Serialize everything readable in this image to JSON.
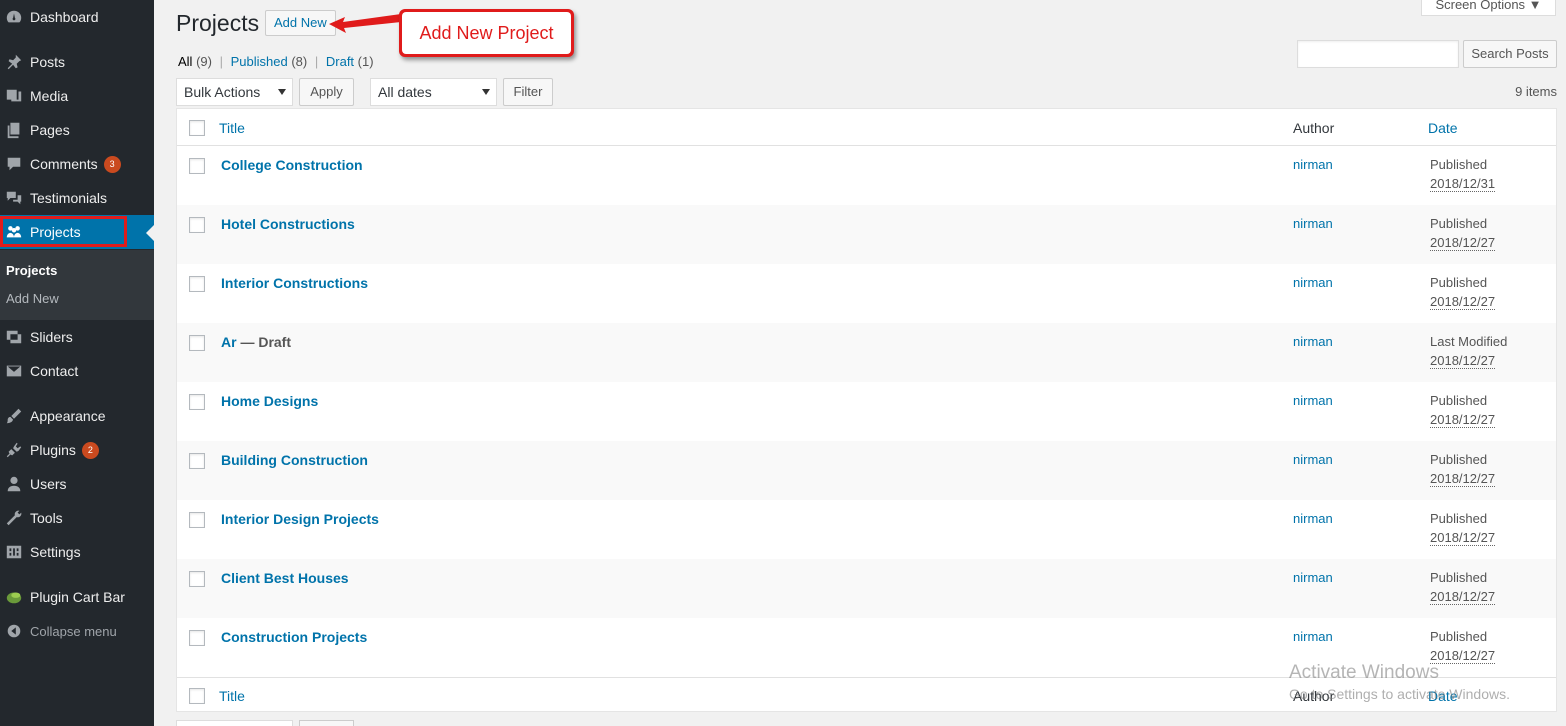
{
  "sidebar": {
    "items": [
      {
        "label": "Dashboard",
        "icon": "dashboard-icon"
      },
      {
        "label": "Posts",
        "icon": "pin-icon"
      },
      {
        "label": "Media",
        "icon": "media-icon"
      },
      {
        "label": "Pages",
        "icon": "pages-icon"
      },
      {
        "label": "Comments",
        "icon": "comment-icon",
        "badge": "3"
      },
      {
        "label": "Testimonials",
        "icon": "testimonial-icon"
      },
      {
        "label": "Projects",
        "icon": "groups-icon"
      },
      {
        "label": "Sliders",
        "icon": "slides-icon"
      },
      {
        "label": "Contact",
        "icon": "email-icon"
      },
      {
        "label": "Appearance",
        "icon": "brush-icon"
      },
      {
        "label": "Plugins",
        "icon": "plugin-icon",
        "badge": "2"
      },
      {
        "label": "Users",
        "icon": "user-icon"
      },
      {
        "label": "Tools",
        "icon": "wrench-icon"
      },
      {
        "label": "Settings",
        "icon": "settings-icon"
      },
      {
        "label": "Plugin Cart Bar",
        "icon": "cart-bar-icon"
      }
    ],
    "submenu": {
      "current": "Projects",
      "add_new": "Add New"
    },
    "collapse": "Collapse menu"
  },
  "header": {
    "title": "Projects",
    "add_new": "Add New",
    "screen_options": "Screen Options ▼"
  },
  "annotation": {
    "text": "Add New Project",
    "color": "#e01b1b"
  },
  "filters": {
    "all": "All",
    "all_count": "(9)",
    "published": "Published",
    "published_count": "(8)",
    "draft": "Draft",
    "draft_count": "(1)"
  },
  "search": {
    "placeholder": "",
    "button": "Search Posts"
  },
  "tablenav": {
    "bulk_actions": "Bulk Actions",
    "apply": "Apply",
    "dates": "All dates",
    "filter": "Filter",
    "items": "9 items"
  },
  "table": {
    "headers": {
      "title": "Title",
      "author": "Author",
      "date": "Date"
    },
    "rows": [
      {
        "title": "College Construction",
        "state": "",
        "author": "nirman",
        "status": "Published",
        "date": "2018/12/31"
      },
      {
        "title": "Hotel Constructions",
        "state": "",
        "author": "nirman",
        "status": "Published",
        "date": "2018/12/27"
      },
      {
        "title": "Interior Constructions",
        "state": "",
        "author": "nirman",
        "status": "Published",
        "date": "2018/12/27"
      },
      {
        "title": "Ar",
        "state": " — Draft",
        "author": "nirman",
        "status": "Last Modified",
        "date": "2018/12/27"
      },
      {
        "title": "Home Designs",
        "state": "",
        "author": "nirman",
        "status": "Published",
        "date": "2018/12/27"
      },
      {
        "title": "Building Construction",
        "state": "",
        "author": "nirman",
        "status": "Published",
        "date": "2018/12/27"
      },
      {
        "title": "Interior Design Projects",
        "state": "",
        "author": "nirman",
        "status": "Published",
        "date": "2018/12/27"
      },
      {
        "title": "Client Best Houses",
        "state": "",
        "author": "nirman",
        "status": "Published",
        "date": "2018/12/27"
      },
      {
        "title": "Construction Projects",
        "state": "",
        "author": "nirman",
        "status": "Published",
        "date": "2018/12/27"
      }
    ]
  },
  "watermark": {
    "line1": "Activate Windows",
    "line2": "Go to Settings to activate Windows."
  },
  "colors": {
    "sidebar_bg": "#23282d",
    "accent": "#0073aa",
    "badge": "#ca4a1f"
  }
}
